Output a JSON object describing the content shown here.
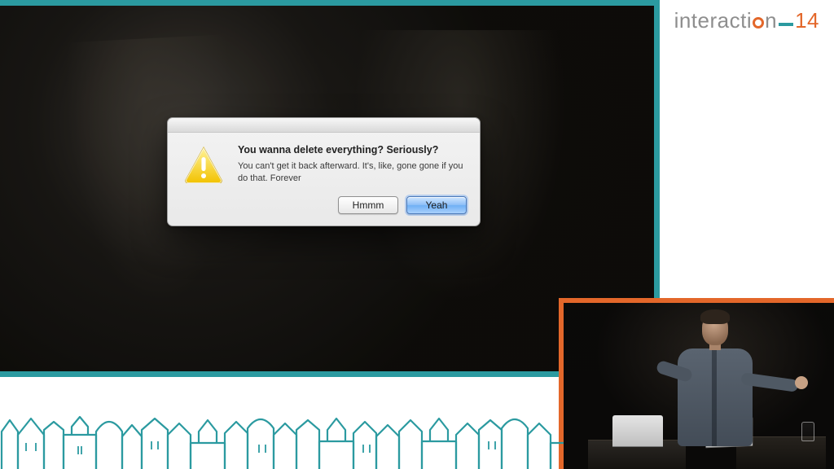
{
  "conference": {
    "name_prefix": "interacti",
    "name_suffix": "n",
    "year": "14"
  },
  "dialog": {
    "title": "You wanna delete everything? Seriously?",
    "body": "You can't get it back afterward. It's, like, gone gone if you do that. Forever",
    "cancel_label": "Hmmm",
    "confirm_label": "Yeah"
  },
  "colors": {
    "teal": "#2b9aa0",
    "orange": "#e3672a"
  }
}
